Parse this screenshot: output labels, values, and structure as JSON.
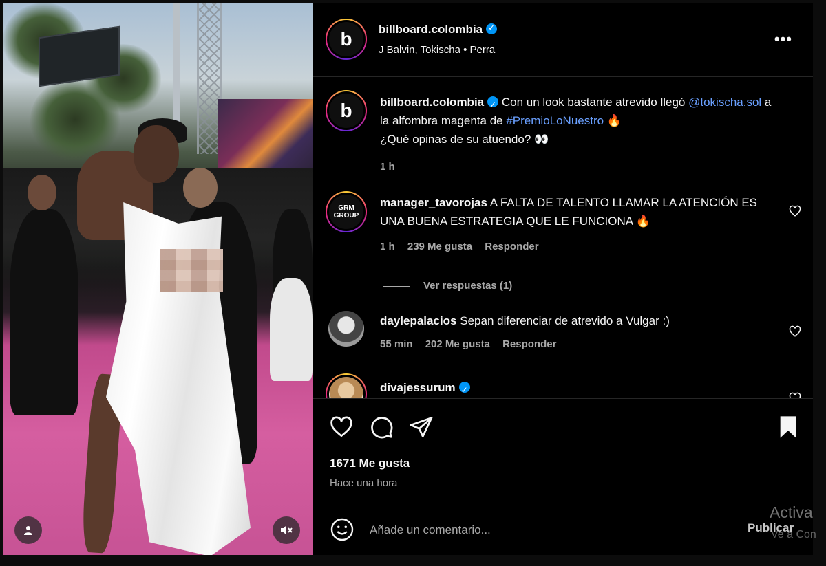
{
  "post": {
    "username": "billboard.colombia",
    "audio_line": "J Balvin, Tokischa • Perra",
    "avatar_text": "b",
    "more_label": "•••"
  },
  "caption": {
    "username": "billboard.colombia",
    "text_1": "Con un look bastante atrevido llegó",
    "mention": "@tokischa.sol",
    "text_2": "a la alfombra magenta de",
    "hashtag": "#PremioLoNuestro",
    "emoji_1": "🔥",
    "text_3": "¿Qué opinas de su atuendo?",
    "emoji_2": "👀",
    "time": "1 h"
  },
  "comments": [
    {
      "username": "manager_tavorojas",
      "avatar_text": "GRM GROUP",
      "text": "A FALTA DE TALENTO LLAMAR LA ATENCIÓN ES UNA BUENA ESTRATEGIA QUE LE FUNCIONA",
      "emoji": "🔥",
      "time": "1 h",
      "likes": "239 Me gusta",
      "reply": "Responder"
    },
    {
      "username": "daylepalacios",
      "text": "Sepan diferenciar de atrevido a Vulgar :)",
      "time": "55 min",
      "likes": "202 Me gusta",
      "reply": "Responder"
    },
    {
      "username": "divajessurum",
      "text": ""
    }
  ],
  "view_replies": "Ver respuestas (1)",
  "footer": {
    "likes": "1671 Me gusta",
    "time": "Hace una hora"
  },
  "add_comment": {
    "placeholder": "Añade un comentario...",
    "publish": "Publicar"
  },
  "os_watermark": {
    "line1": "Activa",
    "line2": "Ve a Con"
  },
  "colors": {
    "background": "#000000",
    "link": "#6aa0ff",
    "verified": "#0095f6",
    "muted_text": "#a8a8a8"
  },
  "icons": [
    "user-icon",
    "mute-icon",
    "heart-icon",
    "comment-icon",
    "share-icon",
    "bookmark-icon",
    "emoji-icon",
    "more-icon",
    "verified-icon"
  ]
}
